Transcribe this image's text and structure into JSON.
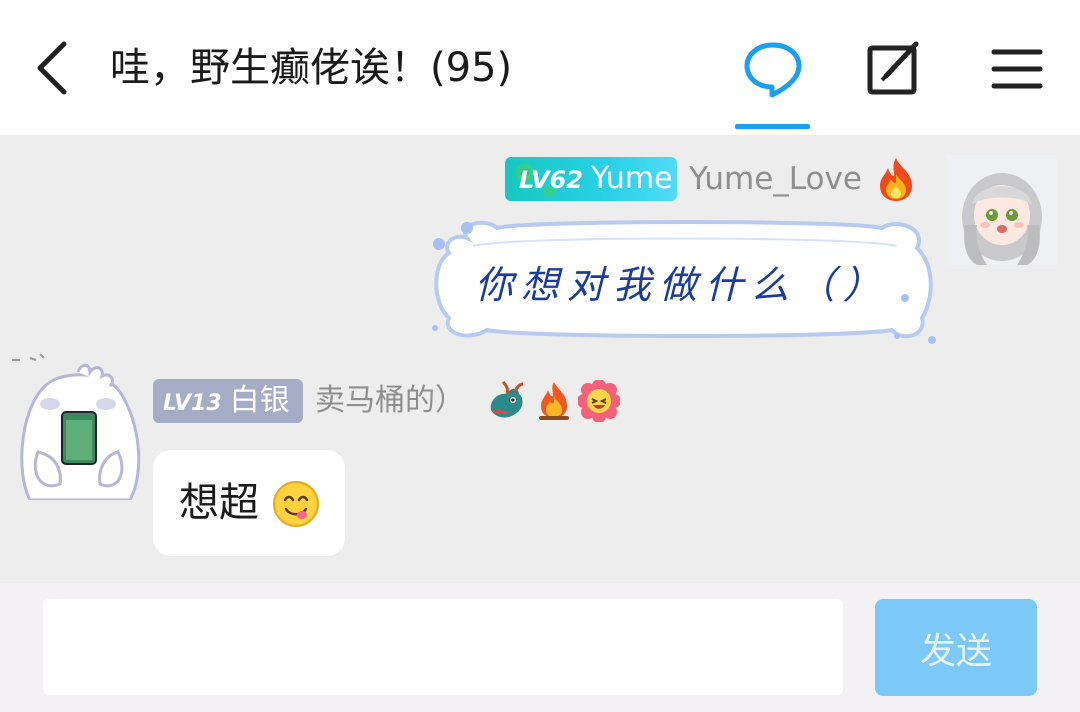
{
  "header": {
    "title": "哇，野生癫佬诶！(95)",
    "icons": [
      "back-arrow-icon",
      "chat-bubble-icon",
      "edit-square-icon",
      "menu-icon"
    ],
    "accent_color": "#1aa0f0"
  },
  "messages": [
    {
      "side": "right",
      "level": "LV62",
      "badge_name": "Yume",
      "username": "Yume_Love",
      "badge_emoji": "fire-icon",
      "text": "你想对我做什么（）"
    },
    {
      "side": "left",
      "level": "LV13",
      "badge_name": "白银",
      "username": "卖马桶的）",
      "badge_emojis": [
        "dragon-emoji",
        "campfire-emoji",
        "flower-face-emoji"
      ],
      "text": "想超",
      "trailing_emoji": "yum-face-emoji"
    }
  ],
  "input": {
    "value": "",
    "placeholder": ""
  },
  "send_label": "发送"
}
